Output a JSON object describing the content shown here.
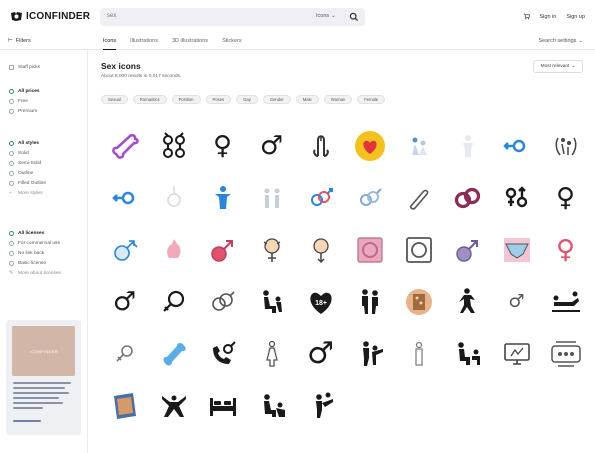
{
  "header": {
    "logo_text": "ICONFINDER",
    "search_value": "sex",
    "search_scope": "Icons",
    "signin": "Sign in",
    "signup": "Sign up"
  },
  "tabs": {
    "filters_label": "Filters",
    "items": [
      "Icons",
      "Illustrations",
      "3D illustrations",
      "Stickers"
    ],
    "active": "Icons",
    "search_settings": "Search settings"
  },
  "sidebar": {
    "staff_picks": "Staff picks",
    "prices": {
      "head": "All prices",
      "items": [
        "Free",
        "Premium"
      ]
    },
    "styles": {
      "head": "All styles",
      "items": [
        "Solid",
        "Semi-Solid",
        "Outline",
        "Filled Outline"
      ],
      "more": "More styles"
    },
    "licenses": {
      "head": "All licenses",
      "items": [
        "For commercial use",
        "No link back",
        "Basic license"
      ],
      "more": "More about licenses"
    },
    "ad_brand": "ICONFINDER"
  },
  "main": {
    "title": "Sex icons",
    "subtitle": "About 8,000 results in 0.017 seconds.",
    "sort": "Most relevant",
    "chips": [
      "Sexual",
      "Romantics",
      "Position",
      "Poses",
      "Gay",
      "Gender",
      "Male",
      "Woman",
      "Female"
    ]
  },
  "colors": {
    "purple": "#a64ccf",
    "blue": "#2a86d6",
    "pink": "#e0526e",
    "dark": "#1a1a1a",
    "maroon": "#8c2b55",
    "gold": "#f4c21f",
    "red": "#e2333b",
    "accent_green": "#2b8a7a"
  },
  "icons": [
    "phallus-outline-icon",
    "sperm-symbol-icon",
    "female-symbol-icon",
    "male-symbol-icon",
    "phallus-figure-icon",
    "heart-badge-icon",
    "couple-figure-icon",
    "ghost-figure-icon",
    "male-blue-icon",
    "couple-silhouette-icon",
    "male-blue-icon-2",
    "neutral-gender-icon",
    "blue-person-icon",
    "two-people-icon",
    "linked-gender-icon",
    "linked-gender-icon-2",
    "phallus-sketch-icon",
    "linked-rings-icon",
    "male-female-icon",
    "female-symbol-icon-2",
    "male-cross-icon",
    "pink-shape-icon",
    "pink-male-icon",
    "baby-girl-icon",
    "baby-boy-icon",
    "condom-icon",
    "condom-outline-icon",
    "purple-male-icon",
    "underwear-icon",
    "female-pink-icon",
    "male-symbol-icon-2",
    "female-cross-icon",
    "linked-gender-outline-icon",
    "couple-sit-icon",
    "heart-18-icon",
    "couple-stand-icon",
    "intimacy-tile-icon",
    "dancer-icon",
    "male-small-icon",
    "couple-lying-icon",
    "female-small-icon",
    "blue-shape-icon",
    "phone-gender-icon",
    "woman-figure-icon",
    "male-bold-icon",
    "couple-kick-icon",
    "person-outline-icon",
    "couple-pose-icon",
    "adult-monitor-icon",
    "adult-sign-icon",
    "book-icon",
    "couple-stretch-icon",
    "bed-icon",
    "couple-kneel-icon",
    "couple-lift-icon"
  ]
}
